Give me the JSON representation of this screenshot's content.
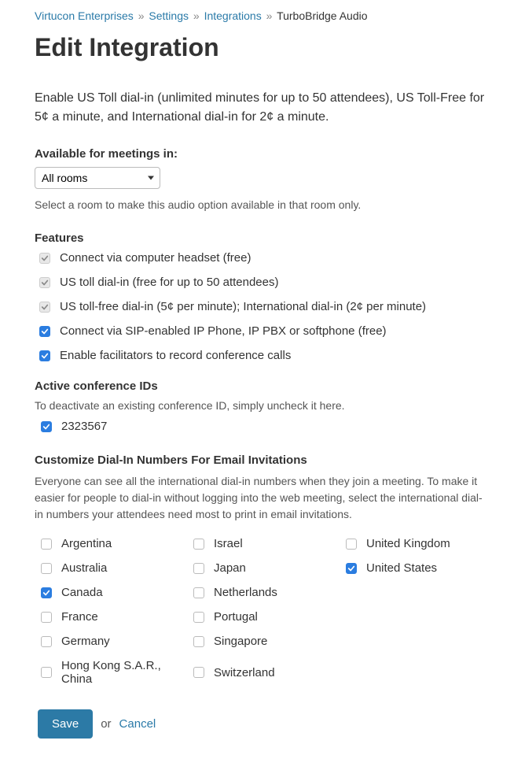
{
  "breadcrumb": {
    "org": "Virtucon Enterprises",
    "settings": "Settings",
    "integrations": "Integrations",
    "current": "TurboBridge Audio"
  },
  "page_title": "Edit Integration",
  "intro": "Enable US Toll dial-in (unlimited minutes for up to 50 attendees), US Toll-Free for 5¢ a minute, and International dial-in for 2¢ a minute.",
  "available": {
    "label": "Available for meetings in:",
    "selected": "All rooms",
    "helper": "Select a room to make this audio option available in that room only."
  },
  "features": {
    "label": "Features",
    "items": [
      {
        "label": "Connect via computer headset (free)",
        "checked": true,
        "style": "gray"
      },
      {
        "label": "US toll dial-in (free for up to 50 attendees)",
        "checked": true,
        "style": "gray"
      },
      {
        "label": "US toll-free dial-in (5¢ per minute); International dial-in (2¢ per minute)",
        "checked": true,
        "style": "gray"
      },
      {
        "label": "Connect via SIP-enabled IP Phone, IP PBX or softphone (free)",
        "checked": true,
        "style": "blue"
      },
      {
        "label": "Enable facilitators to record conference calls",
        "checked": true,
        "style": "blue"
      }
    ]
  },
  "active_ids": {
    "label": "Active conference IDs",
    "helper": "To deactivate an existing conference ID, simply uncheck it here.",
    "items": [
      {
        "label": "2323567",
        "checked": true,
        "style": "blue"
      }
    ]
  },
  "customize": {
    "label": "Customize Dial-In Numbers For Email Invitations",
    "helper": "Everyone can see all the international dial-in numbers when they join a meeting. To make it easier for people to dial-in without logging into the web meeting, select the international dial-in numbers your attendees need most to print in email invitations.",
    "countries": [
      {
        "label": "Argentina",
        "checked": false
      },
      {
        "label": "Australia",
        "checked": false
      },
      {
        "label": "Canada",
        "checked": true
      },
      {
        "label": "France",
        "checked": false
      },
      {
        "label": "Germany",
        "checked": false
      },
      {
        "label": "Hong Kong S.A.R., China",
        "checked": false
      },
      {
        "label": "Israel",
        "checked": false
      },
      {
        "label": "Japan",
        "checked": false
      },
      {
        "label": "Netherlands",
        "checked": false
      },
      {
        "label": "Portugal",
        "checked": false
      },
      {
        "label": "Singapore",
        "checked": false
      },
      {
        "label": "Switzerland",
        "checked": false
      },
      {
        "label": "United Kingdom",
        "checked": false
      },
      {
        "label": "United States",
        "checked": true
      }
    ]
  },
  "actions": {
    "save": "Save",
    "or": "or",
    "cancel": "Cancel"
  }
}
